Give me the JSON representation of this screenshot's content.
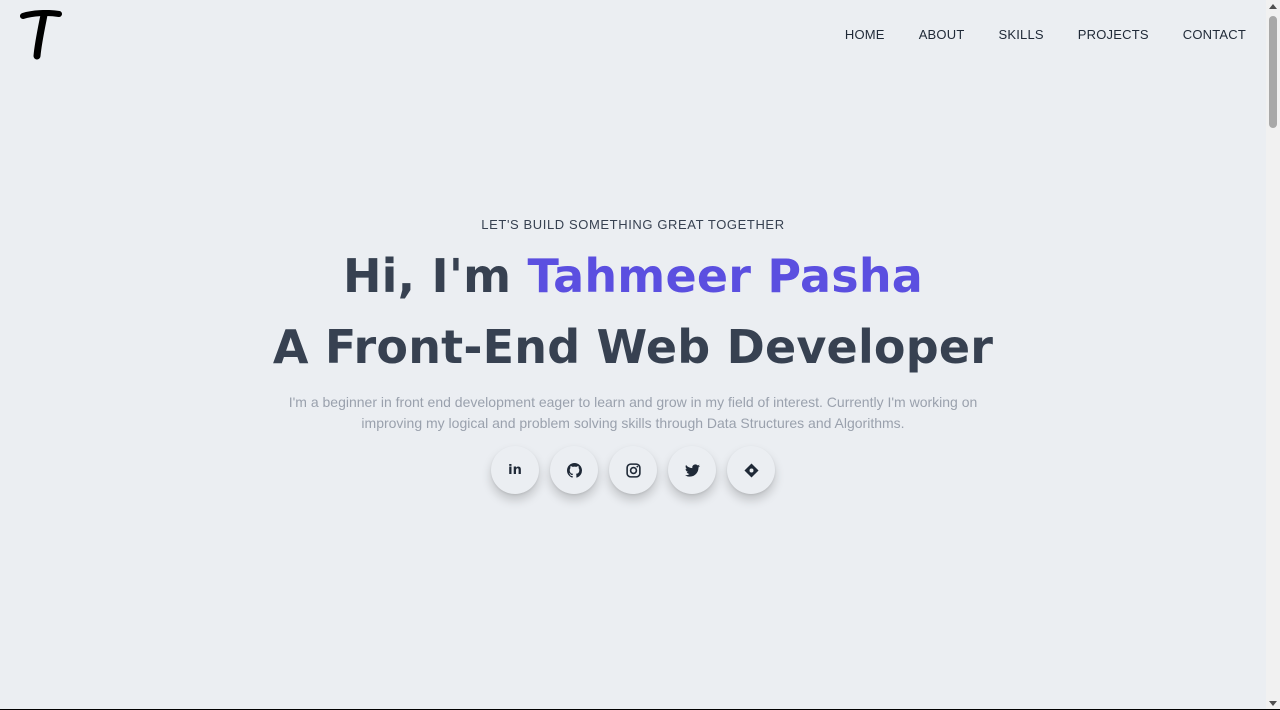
{
  "header": {
    "logo_letter": "T",
    "nav": [
      {
        "label": "HOME"
      },
      {
        "label": "ABOUT"
      },
      {
        "label": "SKILLS"
      },
      {
        "label": "PROJECTS"
      },
      {
        "label": "CONTACT"
      }
    ]
  },
  "hero": {
    "tagline": "LET'S BUILD SOMETHING GREAT TOGETHER",
    "greeting": "Hi, I'm ",
    "name": "Tahmeer Pasha",
    "role": "A Front-End Web Developer",
    "intro": "I'm a beginner in front end development eager to learn and grow in my field of interest. Currently I'm working on improving my logical and problem solving skills through Data Structures and Algorithms."
  },
  "socials": [
    {
      "icon": "linkedin-icon",
      "text": "in"
    },
    {
      "icon": "github-icon"
    },
    {
      "icon": "instagram-icon"
    },
    {
      "icon": "twitter-icon"
    },
    {
      "icon": "codepen-diamond-icon"
    }
  ],
  "colors": {
    "background": "#ebeef2",
    "text": "#374151",
    "accent": "#5b4fe0",
    "muted": "#9aa1ad"
  }
}
